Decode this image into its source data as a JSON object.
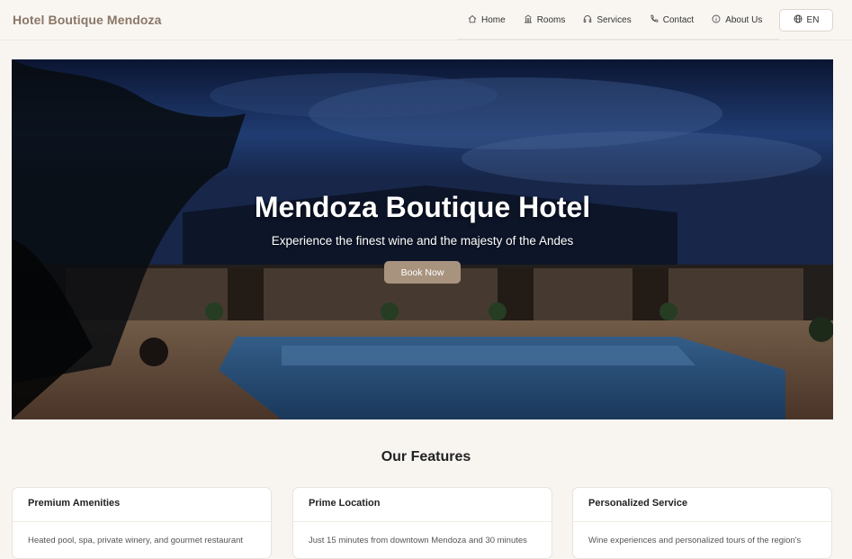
{
  "header": {
    "brand": "Hotel Boutique Mendoza",
    "nav": [
      {
        "label": "Home",
        "icon": "home-icon"
      },
      {
        "label": "Rooms",
        "icon": "building-icon"
      },
      {
        "label": "Services",
        "icon": "headset-icon"
      },
      {
        "label": "Contact",
        "icon": "phone-icon"
      },
      {
        "label": "About Us",
        "icon": "info-icon"
      }
    ],
    "language": {
      "label": "EN",
      "icon": "globe-icon"
    }
  },
  "hero": {
    "title": "Mendoza Boutique Hotel",
    "subtitle": "Experience the finest wine and the majesty of the Andes",
    "cta": "Book Now"
  },
  "features": {
    "title": "Our Features",
    "cards": [
      {
        "title": "Premium Amenities",
        "body": "Heated pool, spa, private winery, and gourmet restaurant"
      },
      {
        "title": "Prime Location",
        "body": "Just 15 minutes from downtown Mendoza and 30 minutes"
      },
      {
        "title": "Personalized Service",
        "body": "Wine experiences and personalized tours of the region's"
      }
    ]
  },
  "colors": {
    "accent": "#a8937f",
    "brand": "#8a7767",
    "background": "#f8f5f1"
  }
}
